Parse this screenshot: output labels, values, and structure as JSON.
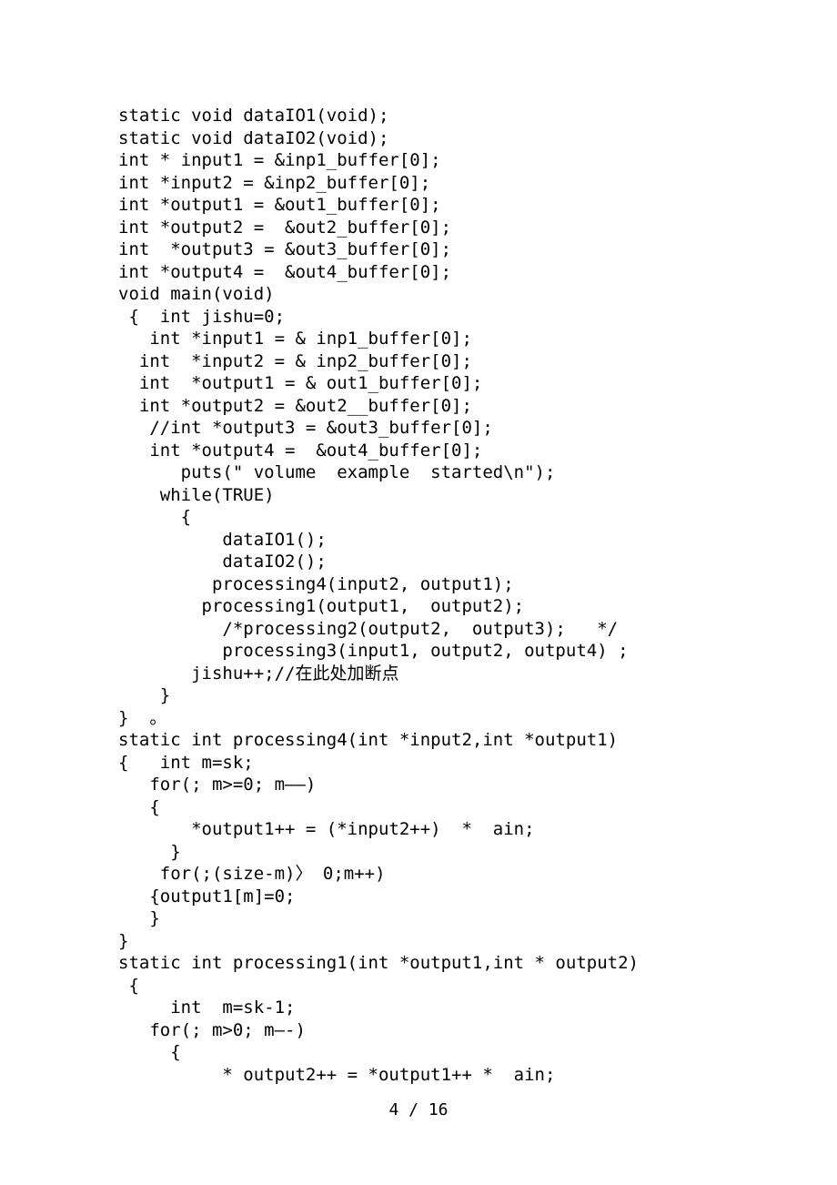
{
  "code": {
    "lines": [
      "static void dataIO1(void);",
      "static void dataIO2(void);",
      "int * input1 = &inp1_buffer[0];",
      "int *input2 = &inp2_buffer[0];",
      "int *output1 = &out1_buffer[0];",
      "int *output2 =  &out2_buffer[0];",
      "int  *output3 = &out3_buffer[0];",
      "int *output4 =  &out4_buffer[0];",
      "void main(void)",
      " {  int jishu=0;",
      "   int *input1 = & inp1_buffer[0];",
      "  int  *input2 = & inp2_buffer[0];",
      "  int  *output1 = & out1_buffer[0];",
      "  int *output2 = &out2__buffer[0];",
      "   //int *output3 = &out3_buffer[0];",
      "   int *output4 =  &out4_buffer[0];",
      "      puts(\" volume  example  started\\n\");",
      "    while(TRUE)",
      "      {",
      "          dataIO1();",
      "          dataIO2();",
      "         processing4(input2, output1);",
      "        processing1(output1,  output2);",
      "          /*processing2(output2,  output3);   */",
      "          processing3(input1, output2, output4) ;",
      "       jishu++;//在此处加断点",
      "    }",
      "}  。",
      "static int processing4(int *input2,int *output1)",
      "{   int m=sk;",
      "   for(; m>=0; m——)",
      "   {",
      "       *output1++ = (*input2++)  *  ain;",
      "     }",
      "    for(;(size-m)〉 0;m++)",
      "   {output1[m]=0;",
      "   }",
      "}",
      "static int processing1(int *output1,int * output2)",
      " {",
      "     int  m=sk-1;",
      "   for(; m>0; m—-)",
      "     {",
      "          * output2++ = *output1++ *  ain;"
    ]
  },
  "footer": "4 / 16"
}
